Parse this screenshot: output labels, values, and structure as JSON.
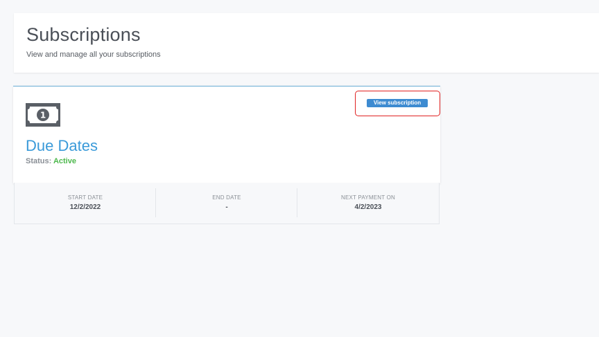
{
  "header": {
    "title": "Subscriptions",
    "subtitle": "View and manage all your subscriptions"
  },
  "subscription": {
    "icon": "banknote-icon",
    "name": "Due Dates",
    "status_label": "Status:",
    "status_value": "Active",
    "status_color": "#4cb84c",
    "view_button_label": "View subscription",
    "dates": [
      {
        "label": "START DATE",
        "value": "12/2/2022"
      },
      {
        "label": "END DATE",
        "value": "-"
      },
      {
        "label": "NEXT PAYMENT ON",
        "value": "4/2/2023"
      }
    ]
  },
  "colors": {
    "accent": "#3a9ad9",
    "button": "#3d8bd1",
    "highlight": "#e02020"
  }
}
